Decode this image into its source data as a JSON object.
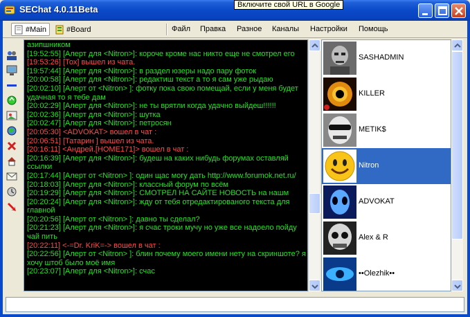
{
  "window": {
    "title": "SEChat 4.0.11Beta",
    "tooltip": "Включите свой URL в Google"
  },
  "tabs": [
    {
      "label": "#Main",
      "active": true
    },
    {
      "label": "#Board",
      "active": false
    }
  ],
  "menu": [
    "Файл",
    "Правка",
    "Разное",
    "Каналы",
    "Настройки",
    "Помощь"
  ],
  "toolbar_icons": [
    "users-icon",
    "monitor-icon",
    "separator-icon",
    "recycle-icon",
    "image-icon",
    "globe-icon",
    "block-icon",
    "home-icon",
    "envelope-icon",
    "clock-icon",
    "exit-icon"
  ],
  "messages": [
    {
      "text": "азипшником",
      "color": "green"
    },
    {
      "text": "[19:52:55] [Алерт для  <Nitron>]: короче кроме нас никто еще не смотрел его",
      "color": "green"
    },
    {
      "text": "[19:53:26]  [Тох] вышел из чата.",
      "color": "red"
    },
    {
      "text": "[19:57:44] [Алерт для  <Nitron>]: в раздел юзеры надо пару фоток",
      "color": "green"
    },
    {
      "text": "[20:00:58] [Алерт для  <Nitron>]: редактиш текст а то я сам уже рыдаю",
      "color": "green"
    },
    {
      "text": "[20:02:10] [Алерт от <Nitron> ]: фотку пока свою помещай, если у меня будет удачная то я тебе дам",
      "color": "green"
    },
    {
      "text": "[20:02:29] [Алерт для  <Nitron>]: не ты врятли когда удачно выйдеш!!!!!!",
      "color": "green"
    },
    {
      "text": "[20:02:36] [Алерт для  <Nitron>]: шутка",
      "color": "green"
    },
    {
      "text": "[20:02:47] [Алерт для  <Nitron>]: петросян",
      "color": "green"
    },
    {
      "text": "[20:05:30] <ADVOKAT> вошел в чат :",
      "color": "red"
    },
    {
      "text": "[20:06:51]  [Татарин ] вышел из чата.",
      "color": "red"
    },
    {
      "text": "[20:16:11] <Андрей.[HOME171]> вошел в чат :",
      "color": "red"
    },
    {
      "text": "[20:16:39] [Алерт для  <Nitron>]: будеш на каких нибудь форумах оставляй ссылки",
      "color": "green"
    },
    {
      "text": "[20:17:44] [Алерт от <Nitron> ]: один щас могу дать http://www.forumok.net.ru/",
      "color": "green"
    },
    {
      "text": "[20:18:03] [Алерт для  <Nitron>]: классный форум по всём",
      "color": "green"
    },
    {
      "text": "[20:19:29] [Алерт для  <Nitron>]: СМОТРЕЛ НА САЙТЕ НОВОСТЬ на нашм",
      "color": "green"
    },
    {
      "text": "[20:20:24] [Алерт для  <Nitron>]: жду от тебя отредактированого текста для главной",
      "color": "green"
    },
    {
      "text": "[20:20:56] [Алерт от <Nitron> ]: давно ты сделал?",
      "color": "green"
    },
    {
      "text": "[20:21:23] [Алерт для  <Nitron>]: я счас троки мучу но уже все надоело пойду чай пить",
      "color": "green"
    },
    {
      "text": "[20:22:11] <-=Dr. KriK=-> вошел в чат :",
      "color": "red"
    },
    {
      "text": "[20:22:56] [Алерт от <Nitron> ]: блин почему моего имени нету на скриншоте? я хочу штоб было моё имя",
      "color": "green"
    },
    {
      "text": "[20:23:07] [Алерт для  <Nitron>]: счас",
      "color": "green"
    }
  ],
  "users": [
    {
      "name": "SASHADMIN",
      "avatar": "robot-avatar",
      "selected": false
    },
    {
      "name": "KILLER",
      "avatar": "eye-avatar",
      "selected": false
    },
    {
      "name": "METIK$",
      "avatar": "skull-sunglasses-avatar",
      "selected": false
    },
    {
      "name": "Nitron",
      "avatar": "smiley-avatar",
      "selected": true
    },
    {
      "name": "ADVOKAT",
      "avatar": "alien-avatar",
      "selected": false
    },
    {
      "name": "Alex & R",
      "avatar": "skull-avatar",
      "selected": false
    },
    {
      "name": "••Olezhik••",
      "avatar": "blue-eye-avatar",
      "selected": false
    }
  ],
  "input": {
    "value": ""
  },
  "colors": {
    "green_text": "#25e125",
    "red_text": "#ff4b4b",
    "selection": "#316ac5",
    "titlebar": "#0a49c8"
  }
}
